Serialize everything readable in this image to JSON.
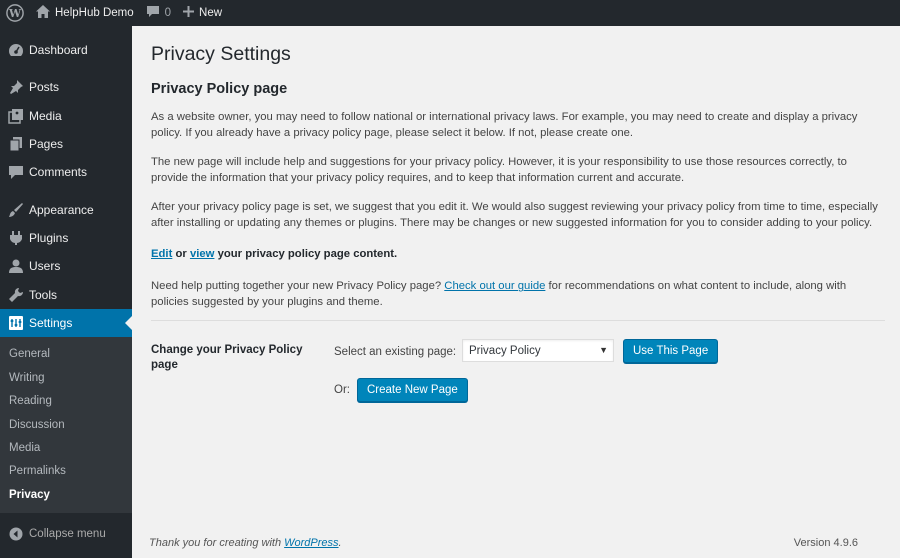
{
  "adminbar": {
    "site_name": "HelpHub Demo",
    "comments_count": "0",
    "new_label": "New"
  },
  "sidebar": {
    "items": [
      {
        "label": "Dashboard",
        "icon": "dashboard-icon"
      },
      {
        "label": "Posts",
        "icon": "pin-icon"
      },
      {
        "label": "Media",
        "icon": "media-icon"
      },
      {
        "label": "Pages",
        "icon": "pages-icon"
      },
      {
        "label": "Comments",
        "icon": "comment-icon"
      },
      {
        "label": "Appearance",
        "icon": "brush-icon"
      },
      {
        "label": "Plugins",
        "icon": "plugin-icon"
      },
      {
        "label": "Users",
        "icon": "user-icon"
      },
      {
        "label": "Tools",
        "icon": "wrench-icon"
      },
      {
        "label": "Settings",
        "icon": "settings-icon"
      }
    ],
    "submenu": [
      "General",
      "Writing",
      "Reading",
      "Discussion",
      "Media",
      "Permalinks",
      "Privacy"
    ],
    "collapse_label": "Collapse menu"
  },
  "main": {
    "title": "Privacy Settings",
    "section_title": "Privacy Policy page",
    "para1": "As a website owner, you may need to follow national or international privacy laws. For example, you may need to create and display a privacy policy. If you already have a privacy policy page, please select it below. If not, please create one.",
    "para2": "The new page will include help and suggestions for your privacy policy. However, it is your responsibility to use those resources correctly, to provide the information that your privacy policy requires, and to keep that information current and accurate.",
    "para3": "After your privacy policy page is set, we suggest that you edit it. We would also suggest reviewing your privacy policy from time to time, especially after installing or updating any themes or plugins. There may be changes or new suggested information for you to consider adding to your policy.",
    "edit_link": "Edit",
    "or_word": "or",
    "view_link": "view",
    "edit_suffix": "your privacy policy page content.",
    "help_prefix": "Need help putting together your new Privacy Policy page?",
    "guide_link": "Check out our guide",
    "help_suffix": "for recommendations on what content to include, along with policies suggested by your plugins and theme.",
    "form_label": "Change your Privacy Policy page",
    "select_label": "Select an existing page:",
    "select_value": "Privacy Policy",
    "use_button": "Use This Page",
    "or_label": "Or:",
    "create_button": "Create New Page"
  },
  "footer": {
    "thanks_prefix": "Thank you for creating with",
    "wp_link": "WordPress",
    "thanks_suffix": ".",
    "version": "Version 4.9.6"
  },
  "colors": {
    "adminbar_bg": "#23282d",
    "accent": "#0073aa",
    "button": "#0085ba"
  }
}
